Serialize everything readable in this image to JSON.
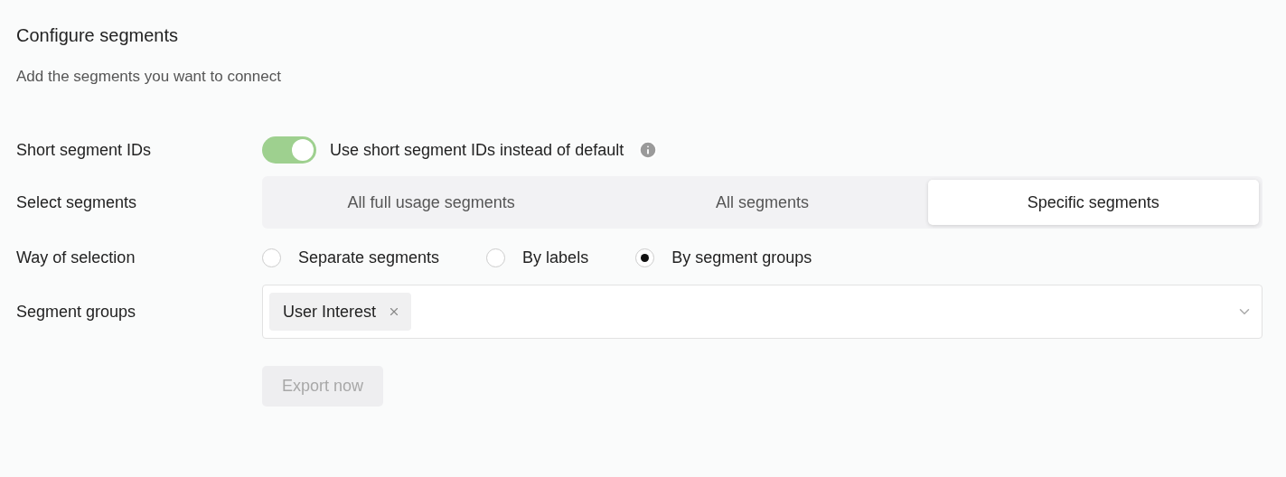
{
  "title": "Configure segments",
  "subtitle": "Add the segments you want to connect",
  "short_ids": {
    "label": "Short segment IDs",
    "toggle_text": "Use short segment IDs instead of default",
    "on": true
  },
  "select_segments": {
    "label": "Select segments",
    "options": [
      {
        "label": "All full usage segments",
        "selected": false
      },
      {
        "label": "All segments",
        "selected": false
      },
      {
        "label": "Specific segments",
        "selected": true
      }
    ]
  },
  "way_of_selection": {
    "label": "Way of selection",
    "options": [
      {
        "label": "Separate segments",
        "selected": false
      },
      {
        "label": "By labels",
        "selected": false
      },
      {
        "label": "By segment groups",
        "selected": true
      }
    ]
  },
  "segment_groups": {
    "label": "Segment groups",
    "tags": [
      "User Interest"
    ]
  },
  "export_button": {
    "label": "Export now",
    "disabled": true
  }
}
